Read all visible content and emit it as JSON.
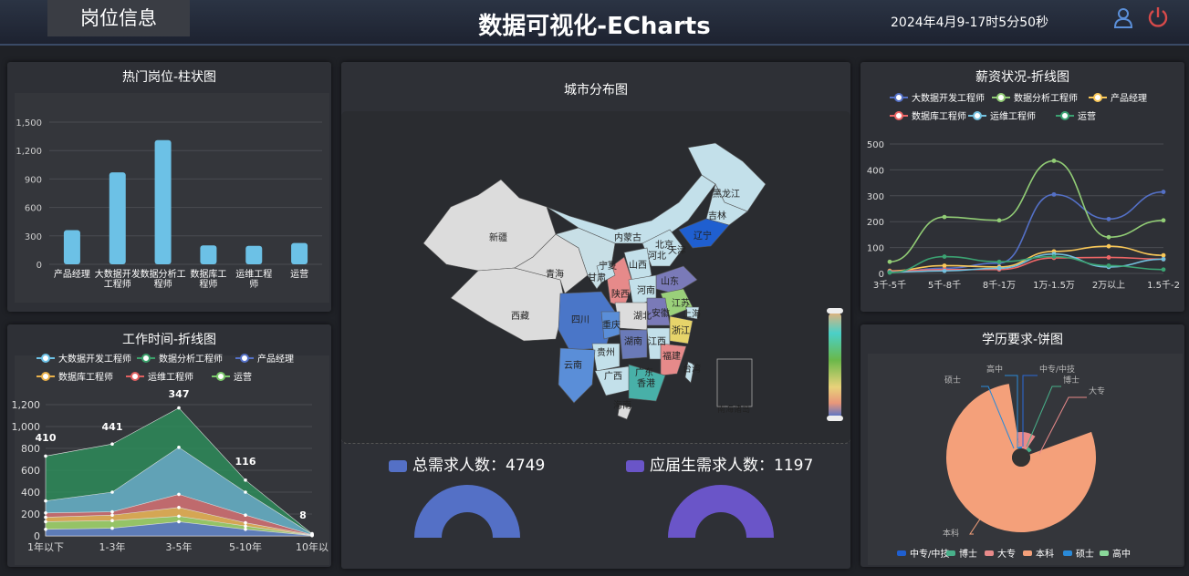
{
  "header": {
    "tab": "岗位信息",
    "title": "数据可视化-ECharts",
    "clock": "2024年4月9-17时5分50秒",
    "user_icon": "user-icon",
    "power_icon": "power-icon"
  },
  "panels": {
    "hot_jobs": "热门岗位-柱状图",
    "work_time": "工作时间-折线图",
    "city_map": "城市分布图",
    "salary": "薪资状况-折线图",
    "education": "学历要求-饼图"
  },
  "colors": {
    "bar": "#6cc1e6",
    "map_bg": "#2a2c30"
  },
  "hot_bar": {
    "type": "bar",
    "categories": [
      "产品经理",
      "大数据开发工程师",
      "数据分析工程师",
      "数据库工程师",
      "运维工程师",
      "运营"
    ],
    "values": [
      360,
      970,
      1310,
      200,
      195,
      225
    ],
    "ylim": [
      0,
      1500
    ],
    "ticks": [
      "0",
      "300",
      "600",
      "900",
      "1,200",
      "1,500"
    ]
  },
  "work_line": {
    "type": "area",
    "categories": [
      "1年以下",
      "1-3年",
      "3-5年",
      "5-10年",
      "10年以上"
    ],
    "x_ticks": [
      "1年以下",
      "1-3年",
      "3-5年",
      "5-10年",
      "10年以"
    ],
    "legend": [
      "大数据开发工程师",
      "数据分析工程师",
      "产品经理",
      "数据库工程师",
      "运维工程师",
      "运营"
    ],
    "ticks": [
      "0",
      "200",
      "400",
      "600",
      "800",
      "1,000",
      "1,200"
    ],
    "labels": [
      "410",
      "441",
      "347",
      "116",
      "8"
    ]
  },
  "salary_line": {
    "type": "line",
    "categories": [
      "3千-5千",
      "5千-8千",
      "8千-1万",
      "1万-1.5万",
      "2万以上",
      "1.5千-2"
    ],
    "legend": [
      "大数据开发工程师",
      "数据分析工程师",
      "产品经理",
      "数据库工程师",
      "运维工程师",
      "运营"
    ],
    "ticks": [
      "0",
      "100",
      "200",
      "300",
      "400",
      "500"
    ]
  },
  "map": {
    "provinces": [
      "新疆",
      "西藏",
      "青海",
      "甘肃",
      "内蒙古",
      "宁夏",
      "陕西",
      "山西",
      "河北",
      "北京",
      "天津",
      "辽宁",
      "吉林",
      "黑龙江",
      "山东",
      "河南",
      "江苏",
      "安徽",
      "上海",
      "湖北",
      "四川",
      "重庆",
      "湖南",
      "江西",
      "浙江",
      "贵州",
      "云南",
      "广西",
      "广东",
      "福建",
      "台湾",
      "香港",
      "海南",
      "南海诸岛"
    ]
  },
  "stats": {
    "total_label": "总需求人数：4749",
    "grad_label": "应届生需求人数：1197"
  },
  "education": {
    "type": "pie",
    "legend": [
      "中专/中技",
      "博士",
      "大专",
      "本科",
      "硕士",
      "高中"
    ],
    "labels": [
      "高中",
      "中专/中技",
      "硕士",
      "博士",
      "大专",
      "本科"
    ]
  }
}
